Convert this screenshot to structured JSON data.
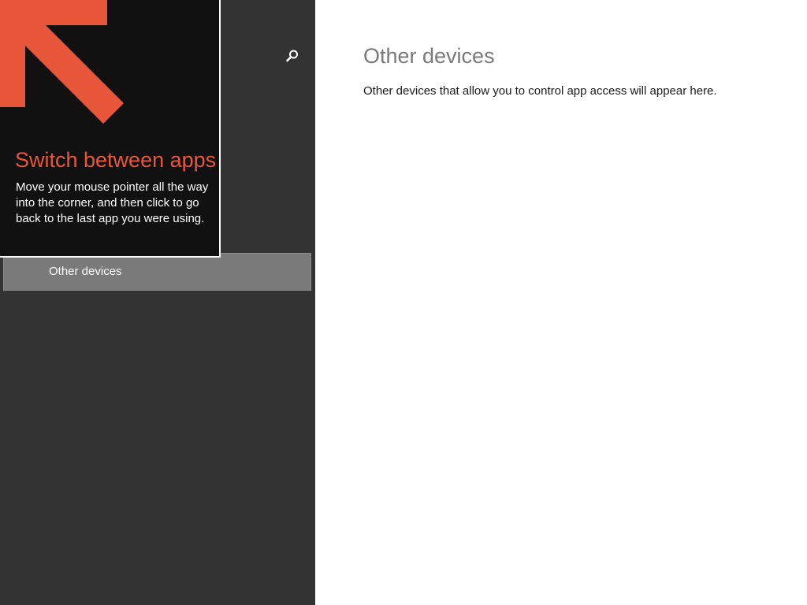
{
  "colors": {
    "nav_background": "#333333",
    "nav_item_selected": "#7a7a7a",
    "content_background": "#ffffff",
    "tip_background": "#111111",
    "accent": "#e8563a"
  },
  "nav": {
    "search_icon": "search-icon",
    "items": [
      {
        "label": "Other devices",
        "selected": true
      }
    ]
  },
  "content": {
    "title": "Other devices",
    "description": "Other devices that allow you to control app access will appear here."
  },
  "tip": {
    "icon": "arrow-up-left-icon",
    "title": "Switch between apps",
    "body": "Move your mouse pointer all the way into the corner, and then click to go back to the last app you were using."
  }
}
